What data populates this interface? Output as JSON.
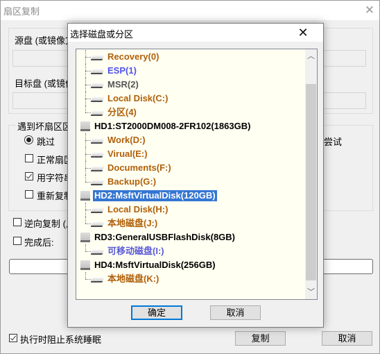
{
  "main_window": {
    "title": "扇区复制",
    "close_icon": "close-icon",
    "source_label": "源盘 (或镜像文",
    "source_value": "",
    "target_label": "目标盘 (或镜像",
    "target_value": "",
    "bad_sector_group_label": "遇到坏扇区区",
    "bad_sector_options": [
      {
        "type": "radio",
        "label": "跳过",
        "checked": true
      },
      {
        "type": "checkbox",
        "label": "正常扇区",
        "checked": false
      },
      {
        "type": "checkbox",
        "label": "用字符串",
        "checked": true
      },
      {
        "type": "checkbox",
        "label": "重新复制",
        "checked": false
      }
    ],
    "retry_text": "尝试",
    "reverse_copy_label": "逆向复制 (从",
    "reverse_copy_checked": false,
    "after_complete_label": "完成后:",
    "after_complete_checked": false,
    "progress_percent": 0,
    "prevent_sleep_label": "执行时阻止系统睡眠",
    "prevent_sleep_checked": true,
    "copy_button": "复制",
    "cancel_button": "取消"
  },
  "dialog": {
    "title": "选择磁盘或分区",
    "close_icon": "close-icon",
    "tree": [
      {
        "kind": "part",
        "label": "Recovery(0)",
        "color": "orange"
      },
      {
        "kind": "part",
        "label": "ESP(1)",
        "color": "blue"
      },
      {
        "kind": "part",
        "label": "MSR(2)",
        "color": "gray"
      },
      {
        "kind": "part",
        "label": "Local Disk(C:)",
        "color": "orange"
      },
      {
        "kind": "part",
        "label": "分区(4)",
        "color": "orange",
        "last": true
      },
      {
        "kind": "disk",
        "label": "HD1:ST2000DM008-2FR102(1863GB)"
      },
      {
        "kind": "part",
        "label": "Work(D:)",
        "color": "orange"
      },
      {
        "kind": "part",
        "label": "Virual(E:)",
        "color": "orange"
      },
      {
        "kind": "part",
        "label": "Documents(F:)",
        "color": "orange"
      },
      {
        "kind": "part",
        "label": "Backup(G:)",
        "color": "orange",
        "last": true
      },
      {
        "kind": "disk",
        "label": "HD2:MsftVirtualDisk(120GB)",
        "selected": true
      },
      {
        "kind": "part",
        "label": "Local Disk(H:)",
        "color": "orange"
      },
      {
        "kind": "part",
        "label": "本地磁盘(J:)",
        "color": "orange",
        "last": true
      },
      {
        "kind": "disk",
        "label": "RD3:GeneralUSBFlashDisk(8GB)"
      },
      {
        "kind": "part",
        "label": "可移动磁盘(I:)",
        "color": "removable",
        "last": true
      },
      {
        "kind": "disk",
        "label": "HD4:MsftVirtualDisk(256GB)"
      },
      {
        "kind": "part",
        "label": "本地磁盘(K:)",
        "color": "orange",
        "last": true
      }
    ],
    "scroll": {
      "thumb_start_fraction": 0.1,
      "thumb_size_fraction": 0.87
    },
    "ok_button": "确定",
    "cancel_button": "取消"
  }
}
